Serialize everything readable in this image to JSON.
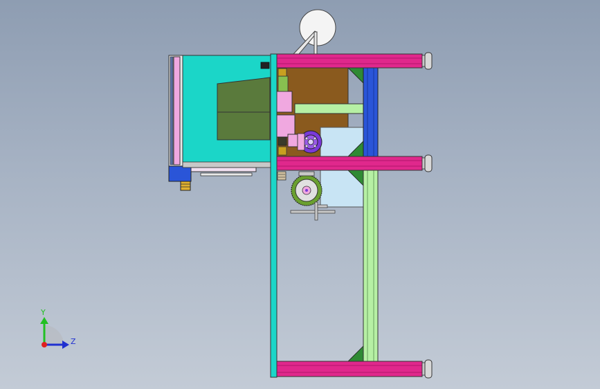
{
  "viewport": {
    "background_top": "#8e9db2",
    "background_bottom": "#c3cbd6"
  },
  "triad": {
    "y_label": "Y",
    "z_label": "Z",
    "y_color": "#22c022",
    "z_color": "#2030d0",
    "origin_color": "#e02020"
  },
  "colors": {
    "cyan_plate": "#1bd6c8",
    "magenta_rail": "#e0288c",
    "blue_column": "#2a55d8",
    "light_green": "#b6f0a4",
    "brown_panel": "#8a5a1e",
    "olive_box": "#5a7a3c",
    "purple_wheel": "#7a3ad8",
    "light_blue_box": "#c8e4f4",
    "pink_parts": "#f0a8e0",
    "dark_green": "#2f8a34",
    "gray_parts": "#c8c8c8"
  }
}
